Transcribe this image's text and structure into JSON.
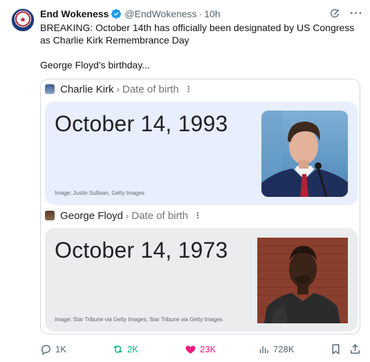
{
  "tweet": {
    "author_name": "End Wokeness",
    "handle": "@EndWokeness",
    "separator": "·",
    "time": "10h",
    "text_line1": "BREAKING: October 14th has officially been designated by US Congress as Charlie Kirk Remembrance Day",
    "text_line2": "George Floyd's birthday..."
  },
  "cards": [
    {
      "subject": "Charlie Kirk",
      "separator": "›",
      "attribute": "Date of birth",
      "date": "October 14, 1993",
      "caption": "Image: Justin Sullivan, Getty Images"
    },
    {
      "subject": "George Floyd",
      "separator": "›",
      "attribute": "Date of birth",
      "date": "October 14, 1973",
      "caption": "Image: Star Tribune via Getty Images, Star Tribune via Getty Images"
    }
  ],
  "actions": {
    "replies": "1K",
    "reposts": "2K",
    "likes": "23K",
    "views": "728K"
  },
  "colors": {
    "verified": "#1d9bf0",
    "repost": "#00ba7c",
    "like": "#f91880",
    "muted": "#536471",
    "card_blue": "#e8eefc",
    "card_gray": "#ebecee"
  },
  "icons": [
    "verified-badge-icon",
    "grok-icon",
    "more-icon",
    "kebab-icon",
    "reply-icon",
    "repost-icon",
    "like-icon",
    "views-icon",
    "bookmark-icon",
    "share-icon"
  ]
}
